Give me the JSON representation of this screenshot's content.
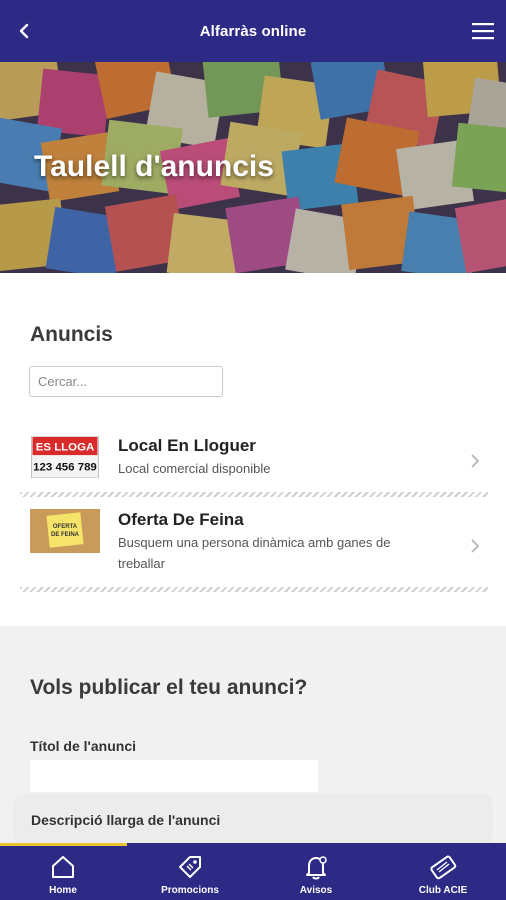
{
  "header": {
    "title": "Alfarràs online"
  },
  "hero": {
    "title": "Taulell d'anuncis"
  },
  "ads_section": {
    "title": "Anuncis",
    "search_placeholder": "Cercar..."
  },
  "ads": [
    {
      "title": "Local En Lloguer",
      "description": "Local comercial disponible",
      "thumb": {
        "line1": "ES LLOGA",
        "line2": "123 456 789"
      }
    },
    {
      "title": "Oferta De Feina",
      "description": "Busquem una persona dinàmica amb ganes de treballar",
      "thumb": {
        "line1": "OFERTA",
        "line2": "DE FEINA"
      }
    }
  ],
  "publish": {
    "title": "Vols publicar el teu anunci?",
    "field_title_label": "Títol de l'anunci",
    "field_desc_label": "Descripció llarga de l'anunci"
  },
  "bottom_nav": {
    "items": [
      {
        "label": "Home",
        "icon": "home-icon"
      },
      {
        "label": "Promocions",
        "icon": "tag-icon"
      },
      {
        "label": "Avisos",
        "icon": "bell-icon"
      },
      {
        "label": "Club ACIE",
        "icon": "card-icon"
      }
    ]
  },
  "colors": {
    "brand": "#2d2a85",
    "accent": "#e8c530"
  }
}
